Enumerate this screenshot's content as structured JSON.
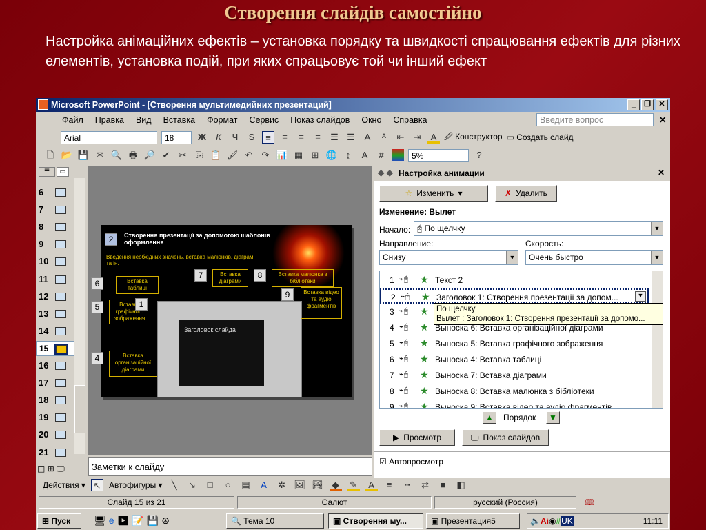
{
  "slide": {
    "title": "Створення слайдів самостійно",
    "intro": "Настройка анімаційних ефектів – установка порядку та швидкості спрацювання ефектів для різних елементів, установка подій, при яких спрацьовує той чи інший ефект"
  },
  "window": {
    "title": "Microsoft PowerPoint - [Створення мультимедийних презентаций]",
    "menu": [
      "Файл",
      "Правка",
      "Вид",
      "Вставка",
      "Формат",
      "Сервис",
      "Показ слайдов",
      "Окно",
      "Справка"
    ],
    "help_placeholder": "Введите вопрос",
    "font": "Arial",
    "font_size": "18",
    "zoom": "5%",
    "designer": "Конструктор",
    "new_slide": "Создать слайд",
    "thumbnails": [
      "6",
      "7",
      "8",
      "9",
      "10",
      "11",
      "12",
      "13",
      "14",
      "15",
      "16",
      "17",
      "18",
      "19",
      "20",
      "21"
    ],
    "selected_slide": "15",
    "mini_slide": {
      "number": "2",
      "heading": "Створення презентації за допомогою шаблонів оформлення",
      "sub": "Введення необхідних значень, вставка малюнків, діаграм та ін.",
      "callouts": [
        {
          "n": "6",
          "text": "Вставка таблиці"
        },
        {
          "n": "7",
          "text": "Вставка діаграми"
        },
        {
          "n": "8",
          "text": "Вставка малюнка з бібліотеки"
        },
        {
          "n": "9",
          "text": "Вставка відео та аудіо фрагментів"
        },
        {
          "n": "5",
          "text": "Вставка графічного зображення"
        },
        {
          "n": "1",
          "text": ""
        },
        {
          "n": "4",
          "text": "Вставка організаційної діаграми"
        }
      ],
      "inner_title": "Заголовок слайда"
    },
    "pane": {
      "title": "Настройка анимации",
      "change": "Изменить",
      "delete": "Удалить",
      "heading": "Изменение: Вылет",
      "start_label": "Начало:",
      "start_value": "По щелчку",
      "direction_label": "Направление:",
      "direction_value": "Снизу",
      "speed_label": "Скорость:",
      "speed_value": "Очень быстро",
      "items": [
        {
          "n": "1",
          "text": "Текст 2"
        },
        {
          "n": "2",
          "text": "Заголовок 1: Створення презентації за допом..."
        },
        {
          "n": "3",
          "text": ""
        },
        {
          "n": "4",
          "text": "Выноска 6: Вставка організаційної діаграми"
        },
        {
          "n": "5",
          "text": "Выноска 5: Вставка графічного зображення"
        },
        {
          "n": "6",
          "text": "Выноска 4: Вставка таблиці"
        },
        {
          "n": "7",
          "text": "Выноска 7: Вставка діаграми"
        },
        {
          "n": "8",
          "text": "Выноска 8: Вставка малюнка з бібліотеки"
        },
        {
          "n": "9",
          "text": "Выноска 9: Вставка відео та аудіо фрагментів"
        }
      ],
      "tooltip_line1": "По щелчку",
      "tooltip_line2": "Вылет : Заголовок 1: Створення презентації за допомо...",
      "order": "Порядок",
      "preview": "Просмотр",
      "slideshow": "Показ слайдов",
      "autopreview": "Автопросмотр",
      "autopreview_checked": true
    },
    "notes_placeholder": "Заметки к слайду",
    "draw": {
      "actions": "Действия",
      "autoshapes": "Автофигуры"
    },
    "status": {
      "slide": "Слайд 15 из 21",
      "design": "Салют",
      "language": "русский (Россия)"
    }
  },
  "taskbar": {
    "start": "Пуск",
    "tasks": [
      "Тема 10",
      "Створення му...",
      "Презентация5"
    ],
    "clock": "11:11"
  },
  "colors": {
    "background": "#8b0a12",
    "title": "#f0c890",
    "titlebar": "#0a246a",
    "callout": "#e8c800"
  }
}
